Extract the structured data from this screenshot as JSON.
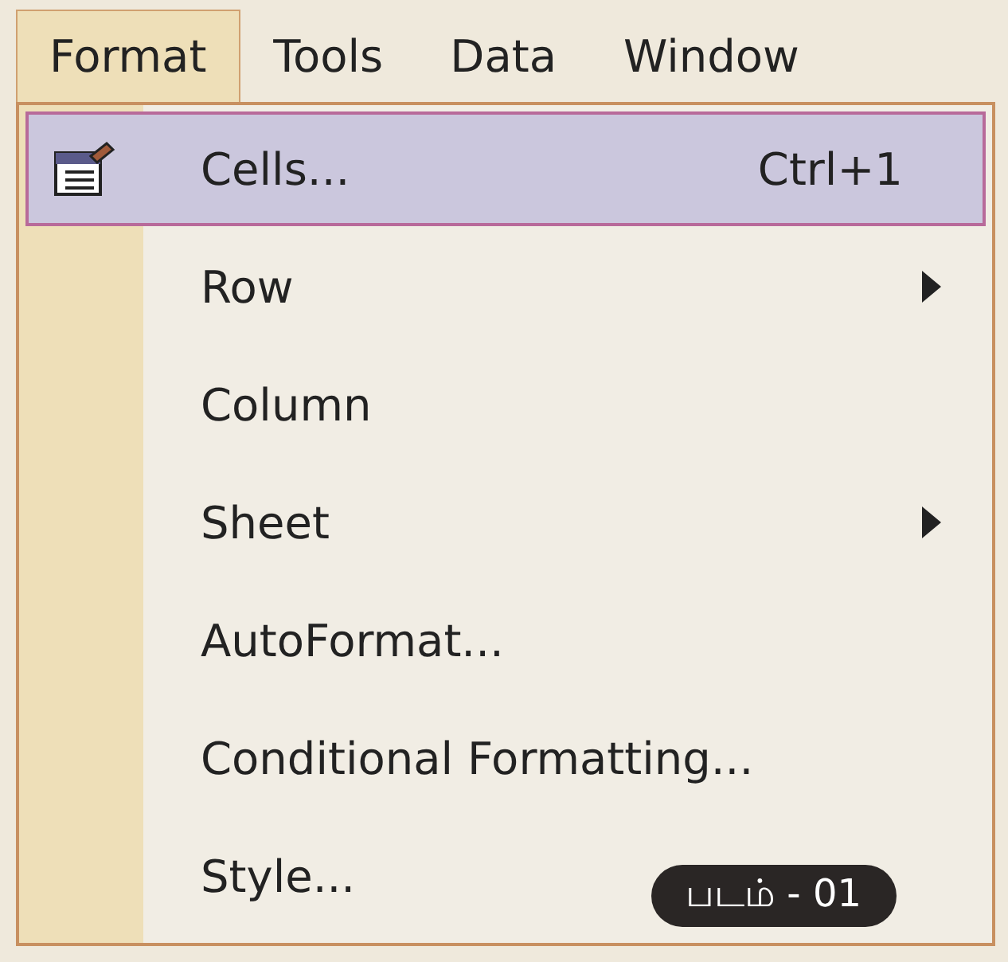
{
  "menu_bar": [
    {
      "label": "Format",
      "selected": true
    },
    {
      "label": "Tools",
      "selected": false
    },
    {
      "label": "Data",
      "selected": false
    },
    {
      "label": "Window",
      "selected": false
    }
  ],
  "menu_items": [
    {
      "label": "Cells...",
      "shortcut": "Ctrl+1",
      "icon": true,
      "submenu": false,
      "selected": true
    },
    {
      "label": "Row",
      "icon": false,
      "submenu": true,
      "selected": false
    },
    {
      "label": "Column",
      "icon": false,
      "submenu": false,
      "selected": false
    },
    {
      "label": "Sheet",
      "icon": false,
      "submenu": true,
      "selected": false
    },
    {
      "label": "AutoFormat...",
      "icon": false,
      "submenu": false,
      "selected": false
    },
    {
      "label": "Conditional Formatting...",
      "icon": false,
      "submenu": false,
      "selected": false
    },
    {
      "label": "Style...",
      "icon": false,
      "submenu": false,
      "selected": false
    }
  ],
  "caption": "படம் - 01"
}
